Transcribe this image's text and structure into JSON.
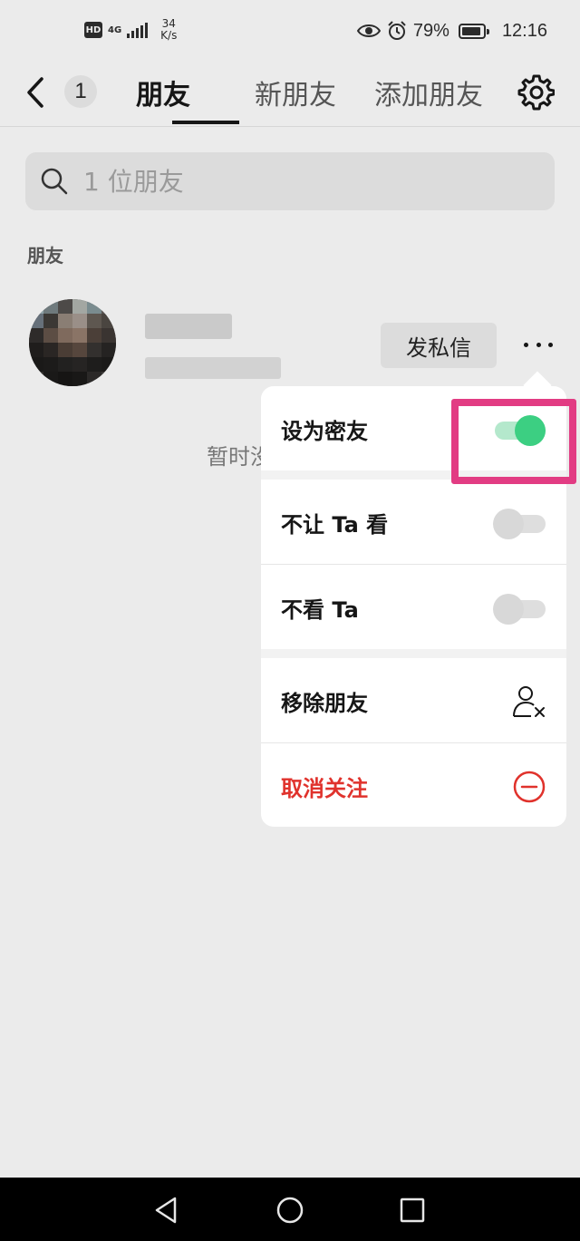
{
  "status_bar": {
    "hd": "HD",
    "network": "4G",
    "speed_value": "34",
    "speed_unit": "K/s",
    "battery_percent": "79%",
    "battery_level": 0.79,
    "time": "12:16",
    "icons": [
      "eye-icon",
      "alarm-icon",
      "battery-icon"
    ]
  },
  "header": {
    "back_icon": "chevron-left-icon",
    "badge_count": "1",
    "tabs": [
      {
        "label": "朋友",
        "active": true
      },
      {
        "label": "新朋友",
        "active": false
      },
      {
        "label": "添加朋友",
        "active": false
      }
    ],
    "settings_icon": "gear-icon"
  },
  "search": {
    "placeholder": "1 位朋友",
    "value": ""
  },
  "section": {
    "label": "朋友"
  },
  "friend": {
    "dm_label": "发私信",
    "more_icon": "more-dots-icon"
  },
  "empty_text": "暂时没",
  "menu": {
    "items": [
      {
        "label": "设为密友",
        "control": "toggle",
        "on": true
      },
      {
        "label": "不让 Ta 看",
        "control": "toggle",
        "on": false
      },
      {
        "label": "不看 Ta",
        "control": "toggle",
        "on": false
      },
      {
        "label": "移除朋友",
        "icon": "remove-user-icon"
      },
      {
        "label": "取消关注",
        "icon": "minus-circle-icon"
      }
    ]
  },
  "colors": {
    "accent_green": "#3ccf82",
    "danger_red": "#e0322c",
    "highlight_pink": "#e23c83",
    "background": "#ebebeb"
  }
}
